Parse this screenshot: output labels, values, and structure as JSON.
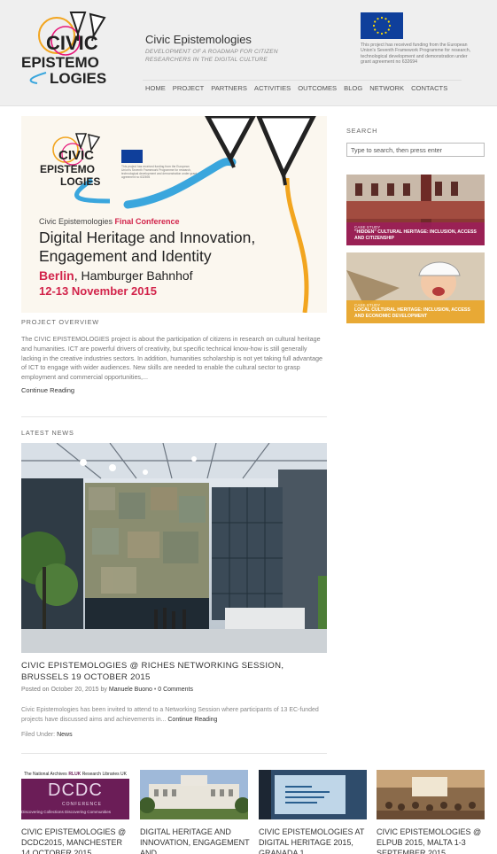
{
  "header": {
    "site_title": "Civic Epistemologies",
    "tagline": "DEVELOPMENT OF A ROADMAP FOR CITIZEN RESEARCHERS IN THE DIGITAL CULTURE",
    "eu_notice": "This project has received funding from the European Union's Seventh Framework Programme for research, technological development and demonstration under grant agreement no 632694",
    "logo_text": [
      "CIVIC",
      "EPISTEMO",
      "LOGIES"
    ],
    "nav": [
      "HOME",
      "PROJECT",
      "PARTNERS",
      "ACTIVITIES",
      "OUTCOMES",
      "BLOG",
      "NETWORK",
      "CONTACTS"
    ]
  },
  "banner": {
    "conference_prefix": "Civic Epistemologies",
    "conference_label": "Final Conference",
    "title": "Digital Heritage and Innovation, Engagement and Identity",
    "city": "Berlin",
    "venue": ", Hamburger Bahnhof",
    "dates": "12-13 November 2015"
  },
  "overview": {
    "heading": "PROJECT OVERVIEW",
    "text": "The CIVIC EPISTEMOLOGIES project is about the participation of citizens in research on cultural heritage and humanities. ICT are powerful drivers of creativity, but specific technical know-how is still generally lacking in the creative industries sectors. In addition, humanities scholarship is not yet taking full advantage of ICT to engage with wider audiences. New skills are needed to enable the cultural sector to grasp employment and commercial opportunities,...",
    "continue_label": "Continue Reading"
  },
  "latest_news": {
    "heading": "LATEST NEWS",
    "title": "CIVIC EPISTEMOLOGIES @ RICHES NETWORKING SESSION, BRUSSELS 19 OCTOBER 2015",
    "meta_prefix": "Posted on October 20, 2015 by",
    "author": "Manuele Buono",
    "comments": "0 Comments",
    "excerpt": "Civic Epistemologies has been invited to attend to a Networking Session where participants of 13 EC-funded projects have discussed aims and achievements in...",
    "continue_label": "Continue Reading",
    "filed_label": "Filed Under:",
    "category": "News"
  },
  "sidebar": {
    "search_label": "SEARCH",
    "search_placeholder": "Type to search, then press enter",
    "cases": [
      {
        "tag": "CASE STUDY",
        "title": "\"HIDDEN\" CULTURAL HERITAGE: INCLUSION, ACCESS AND CITIZENSHIP"
      },
      {
        "tag": "CASE STUDY",
        "title": "LOCAL CULTURAL HERITAGE: INCLUSION, ACCESS AND ECONOMIC DEVELOPMENT"
      }
    ]
  },
  "grid": [
    {
      "title": "CIVIC EPISTEMOLOGIES @ DCDC2015, MANCHESTER 14 OCTOBER 2015",
      "thumb_big": "DCDC",
      "thumb_small": "CONFERENCE",
      "thumb_top": "The National Archives",
      "thumb_brand": "RLUK",
      "thumb_sub": "Research Libraries UK",
      "thumb_bottom": "Discovering Collections Discovering Communities"
    },
    {
      "title": "DIGITAL HERITAGE AND INNOVATION, ENGAGEMENT AND"
    },
    {
      "title": "CIVIC EPISTEMOLOGIES AT DIGITAL HERITAGE 2015, GRANADA 1"
    },
    {
      "title": "CIVIC EPISTEMOLOGIES @ ELPUB 2015, MALTA 1-3 SEPTEMBER 2015"
    }
  ],
  "colors": {
    "accent": "#d2234a",
    "eu_blue": "#0f3f9b",
    "case_purple": "#9c1d5c",
    "case_orange": "#e9a423"
  }
}
